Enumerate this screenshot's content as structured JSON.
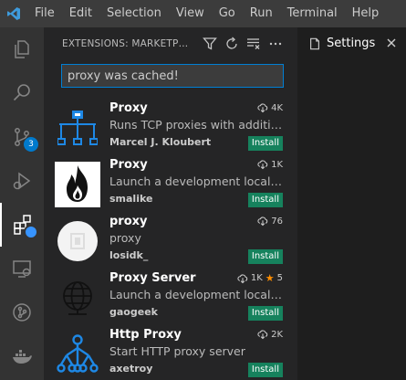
{
  "menu": [
    "File",
    "Edit",
    "Selection",
    "View",
    "Go",
    "Run",
    "Terminal",
    "Help"
  ],
  "activity_bar": {
    "source_control_badge": "3"
  },
  "sidebar": {
    "title": "EXTENSIONS: MARKETPLACE",
    "search_value": "proxy was cached!"
  },
  "extensions": [
    {
      "name": "Proxy",
      "downloads": "4K",
      "rating": "",
      "description": "Runs TCP proxies with additional features",
      "publisher": "Marcel J. Kloubert",
      "action": "Install"
    },
    {
      "name": "Proxy",
      "downloads": "1K",
      "rating": "",
      "description": "Launch a development local Server",
      "publisher": "smalike",
      "action": "Install"
    },
    {
      "name": "proxy",
      "downloads": "76",
      "rating": "",
      "description": "proxy",
      "publisher": "losidk_",
      "action": "Install"
    },
    {
      "name": "Proxy Server",
      "downloads": "1K",
      "rating": "5",
      "description": "Launch a development local Server",
      "publisher": "gaogeek",
      "action": "Install"
    },
    {
      "name": "Http Proxy",
      "downloads": "2K",
      "rating": "",
      "description": "Start HTTP proxy server",
      "publisher": "axetroy",
      "action": "Install"
    }
  ],
  "editor": {
    "tab_label": "Settings"
  },
  "colors": {
    "accent": "#007acc",
    "install": "#16825d",
    "star": "#ff8e00"
  }
}
